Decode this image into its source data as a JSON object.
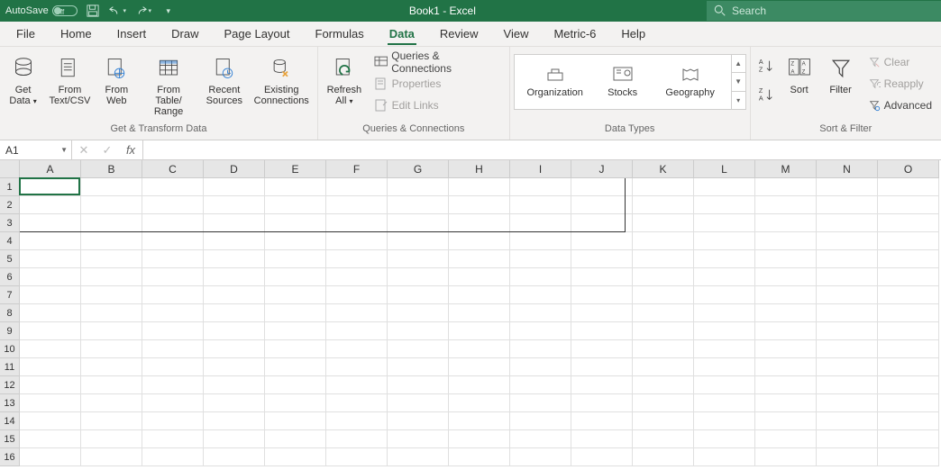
{
  "titlebar": {
    "autosave_label": "AutoSave",
    "autosave_state": "Off",
    "title": "Book1  -  Excel",
    "search_placeholder": "Search"
  },
  "tabs": [
    "File",
    "Home",
    "Insert",
    "Draw",
    "Page Layout",
    "Formulas",
    "Data",
    "Review",
    "View",
    "Metric-6",
    "Help"
  ],
  "active_tab": "Data",
  "ribbon": {
    "groups": {
      "get_transform": {
        "label": "Get & Transform Data",
        "buttons": {
          "get_data": "Get\nData",
          "from_text_csv": "From\nText/CSV",
          "from_web": "From\nWeb",
          "from_table_range": "From Table/\nRange",
          "recent_sources": "Recent\nSources",
          "existing_connections": "Existing\nConnections"
        }
      },
      "queries_connections": {
        "label": "Queries & Connections",
        "refresh_all": "Refresh\nAll",
        "queries_connections": "Queries & Connections",
        "properties": "Properties",
        "edit_links": "Edit Links"
      },
      "data_types": {
        "label": "Data Types",
        "organization": "Organization",
        "stocks": "Stocks",
        "geography": "Geography"
      },
      "sort_filter": {
        "label": "Sort & Filter",
        "sort": "Sort",
        "filter": "Filter",
        "clear": "Clear",
        "reapply": "Reapply",
        "advanced": "Advanced"
      }
    }
  },
  "formula_bar": {
    "name_box": "A1",
    "formula": ""
  },
  "grid": {
    "columns": [
      "A",
      "B",
      "C",
      "D",
      "E",
      "F",
      "G",
      "H",
      "I",
      "J",
      "K",
      "L",
      "M",
      "N",
      "O"
    ],
    "rows": [
      1,
      2,
      3,
      4,
      5,
      6,
      7,
      8,
      9,
      10,
      11,
      12,
      13,
      14,
      15,
      16
    ],
    "active_cell": "A1"
  },
  "colors": {
    "brand": "#217346"
  }
}
